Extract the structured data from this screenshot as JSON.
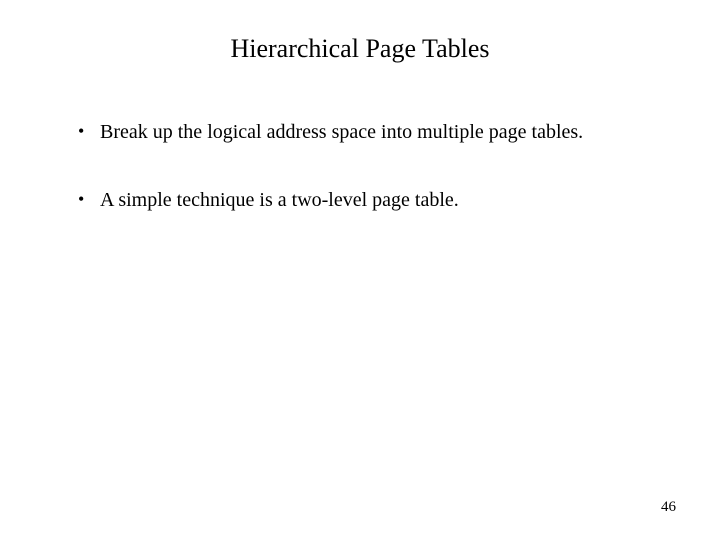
{
  "slide": {
    "title": "Hierarchical Page Tables",
    "bullets": [
      "Break up the logical address space into multiple page tables.",
      "A simple technique is a two-level page table."
    ],
    "page_number": "46"
  }
}
